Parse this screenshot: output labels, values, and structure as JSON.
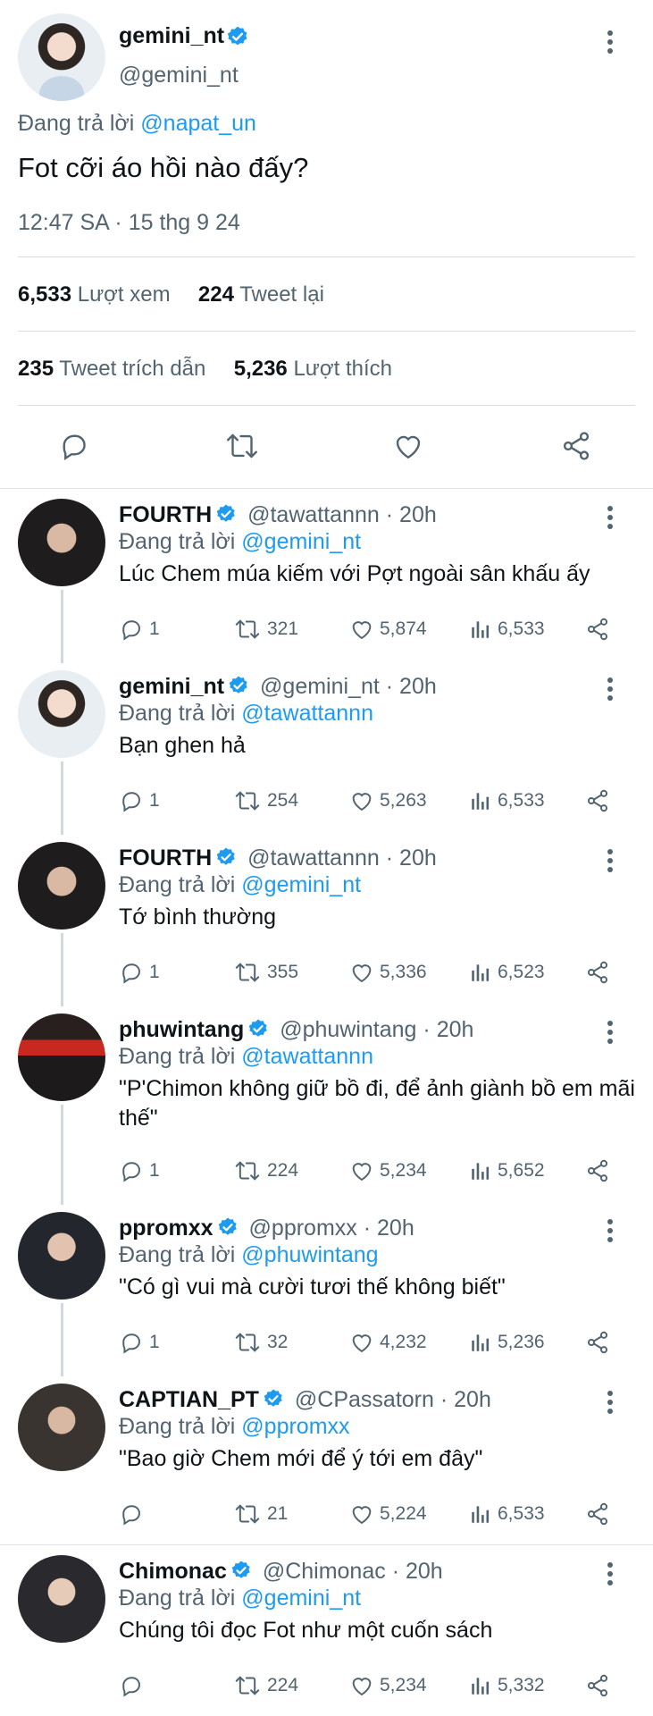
{
  "main_tweet": {
    "name": "gemini_nt",
    "handle": "@gemini_nt",
    "reply_prefix": "Đang trả lời",
    "reply_to": "@napat_un",
    "text": "Fot cỡi áo hồi nào đấy?",
    "timestamp": "12:47 SA · 15 thg 9 24",
    "views_count": "6,533",
    "views_label": "Lượt xem",
    "retweets_count": "224",
    "retweets_label": "Tweet lại",
    "quotes_count": "235",
    "quotes_label": "Tweet trích dẫn",
    "likes_count": "5,236",
    "likes_label": "Lượt thích"
  },
  "colors": {
    "link": "#1d9bf0",
    "verified": "#1d9bf0",
    "muted": "#536471",
    "text": "#0f1419"
  },
  "replies": [
    {
      "name": "FOURTH",
      "handle": "@tawattannn",
      "time": "· 20h",
      "reply_prefix": "Đang trả lời",
      "reply_to": "@gemini_nt",
      "text": "Lúc Chem múa kiếm với Pợt ngoài sân khấu ấy",
      "replies": "1",
      "retweets": "321",
      "likes": "5,874",
      "views": "6,533"
    },
    {
      "name": "gemini_nt",
      "handle": "@gemini_nt",
      "time": "· 20h",
      "reply_prefix": "Đang trả lời",
      "reply_to": "@tawattannn",
      "text": "Bạn ghen hả",
      "replies": "1",
      "retweets": "254",
      "likes": "5,263",
      "views": "6,533"
    },
    {
      "name": "FOURTH",
      "handle": "@tawattannn",
      "time": "· 20h",
      "reply_prefix": "Đang trả lời",
      "reply_to": "@gemini_nt",
      "text": "Tớ bình thường",
      "replies": "1",
      "retweets": "355",
      "likes": "5,336",
      "views": "6,523"
    },
    {
      "name": "phuwintang",
      "handle": "@phuwintang",
      "time": "· 20h",
      "reply_prefix": "Đang trả lời",
      "reply_to": "@tawattannn",
      "text": "\"P'Chimon không giữ bồ đi, để ảnh giành bồ em mãi thế\"",
      "replies": "1",
      "retweets": "224",
      "likes": "5,234",
      "views": "5,652"
    },
    {
      "name": "ppromxx",
      "handle": "@ppromxx",
      "time": "· 20h",
      "reply_prefix": "Đang trả lời",
      "reply_to": "@phuwintang",
      "text": "\"Có gì vui mà cười tươi thế không biết\"",
      "replies": "1",
      "retweets": "32",
      "likes": "4,232",
      "views": "5,236"
    },
    {
      "name": "CAPTIAN_PT",
      "handle": "@CPassatorn",
      "time": "· 20h",
      "reply_prefix": "Đang trả lời",
      "reply_to": "@ppromxx",
      "text": "\"Bao giờ Chem mới để ý tới em đây\"",
      "replies": "",
      "retweets": "21",
      "likes": "5,224",
      "views": "6,533"
    },
    {
      "name": "Chimonac",
      "handle": "@Chimonac",
      "time": "· 20h",
      "reply_prefix": "Đang trả lời",
      "reply_to": "@gemini_nt",
      "text": "Chúng tôi đọc Fot như một cuốn sách",
      "replies": "",
      "retweets": "224",
      "likes": "5,234",
      "views": "5,332"
    }
  ]
}
